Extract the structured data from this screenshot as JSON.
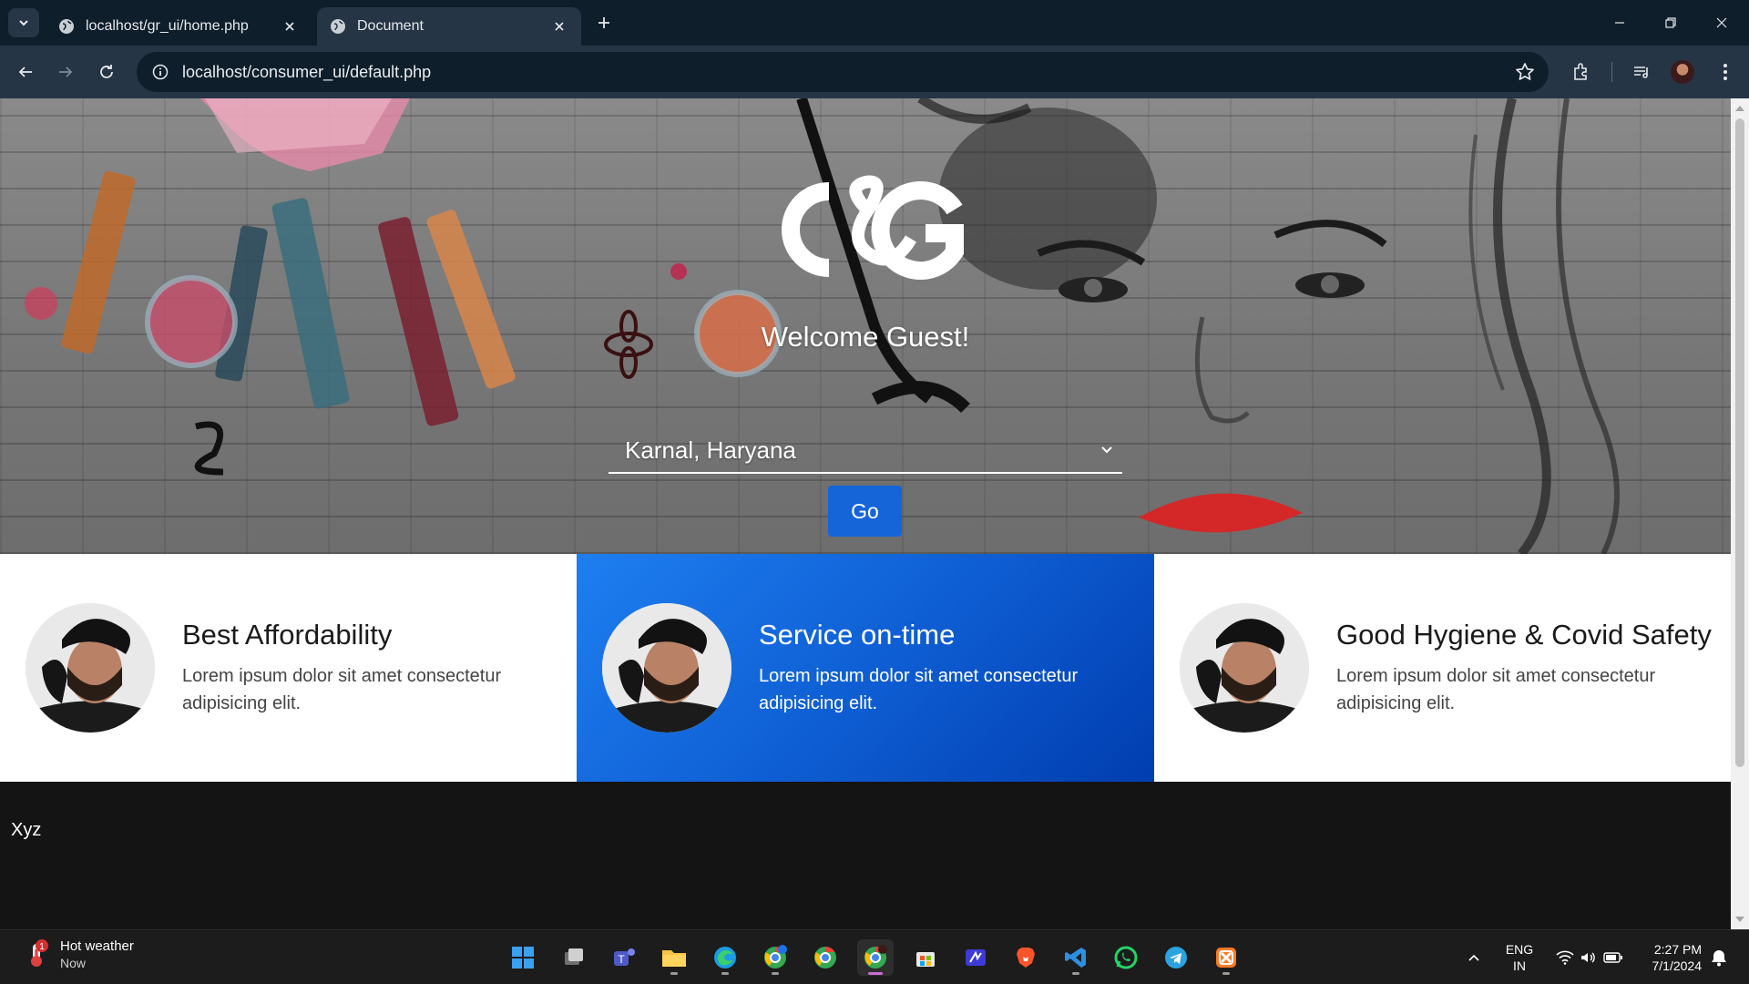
{
  "browser": {
    "tabs": [
      {
        "title": "localhost/gr_ui/home.php",
        "active": false
      },
      {
        "title": "Document",
        "active": true
      }
    ],
    "url": "localhost/consumer_ui/default.php"
  },
  "hero": {
    "logo_text": "C&G",
    "welcome": "Welcome Guest!",
    "city_selected": "Karnal, Haryana",
    "go_label": "Go"
  },
  "features": [
    {
      "title": "Best Affordability",
      "desc": "Lorem ipsum dolor sit amet consectetur adipisicing elit.",
      "highlight": false
    },
    {
      "title": "Service on-time",
      "desc": "Lorem ipsum dolor sit amet consectetur adipisicing elit.",
      "highlight": true
    },
    {
      "title": "Good Hygiene & Covid Safety",
      "desc": "Lorem ipsum dolor sit amet consectetur adipisicing elit.",
      "highlight": false
    }
  ],
  "footer": {
    "text": "Xyz"
  },
  "taskbar": {
    "weather_title": "Hot weather",
    "weather_sub": "Now",
    "weather_badge": "1",
    "lang_top": "ENG",
    "lang_bottom": "IN",
    "time": "2:27 PM",
    "date": "7/1/2024"
  },
  "colors": {
    "accent_blue": "#1565d8",
    "highlight_gradient_start": "#1e7ff0",
    "highlight_gradient_end": "#003db0",
    "chrome_dark": "#0f1e2b",
    "chrome_toolbar": "#253545"
  }
}
